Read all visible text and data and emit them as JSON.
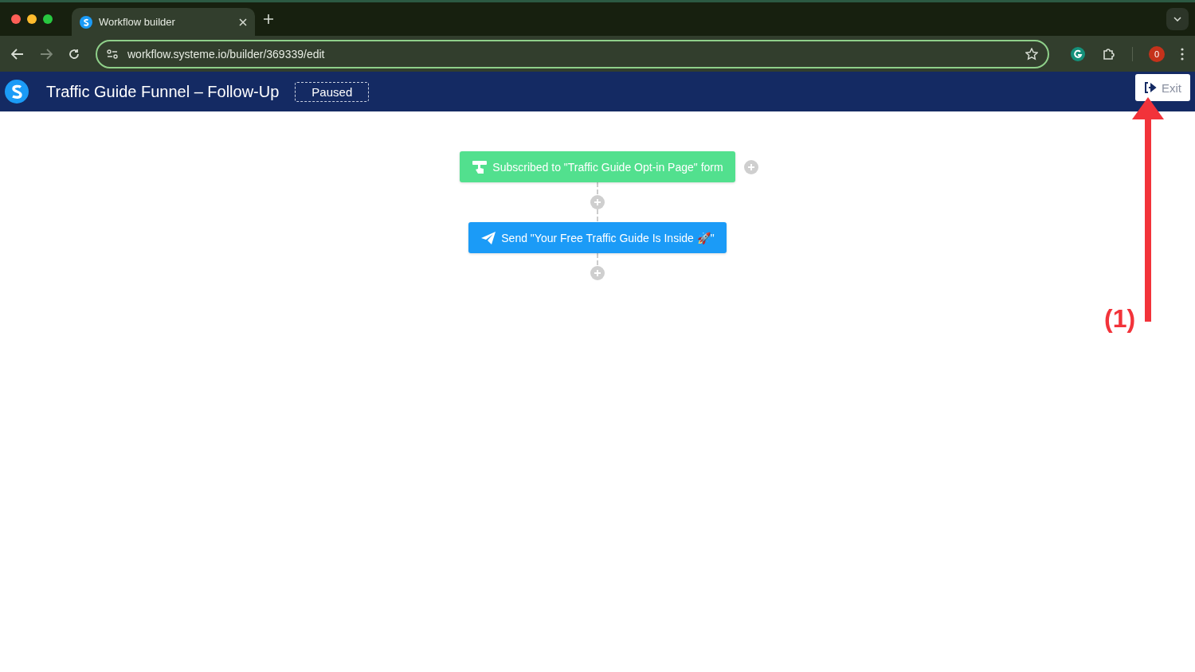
{
  "browser": {
    "tab": {
      "title": "Workflow builder",
      "selected": true
    },
    "url": "workflow.systeme.io/builder/369339/edit",
    "extension_badge": "0"
  },
  "header": {
    "title": "Traffic Guide Funnel – Follow-Up",
    "status": "Paused",
    "exit_label": "Exit"
  },
  "workflow": {
    "nodes": [
      {
        "kind": "trigger",
        "label": "Subscribed to \"Traffic Guide Opt-in Page\" form"
      },
      {
        "kind": "action",
        "label": "Send \"Your Free Traffic Guide Is Inside 🚀\""
      }
    ]
  },
  "annotation": {
    "label": "(1)"
  }
}
